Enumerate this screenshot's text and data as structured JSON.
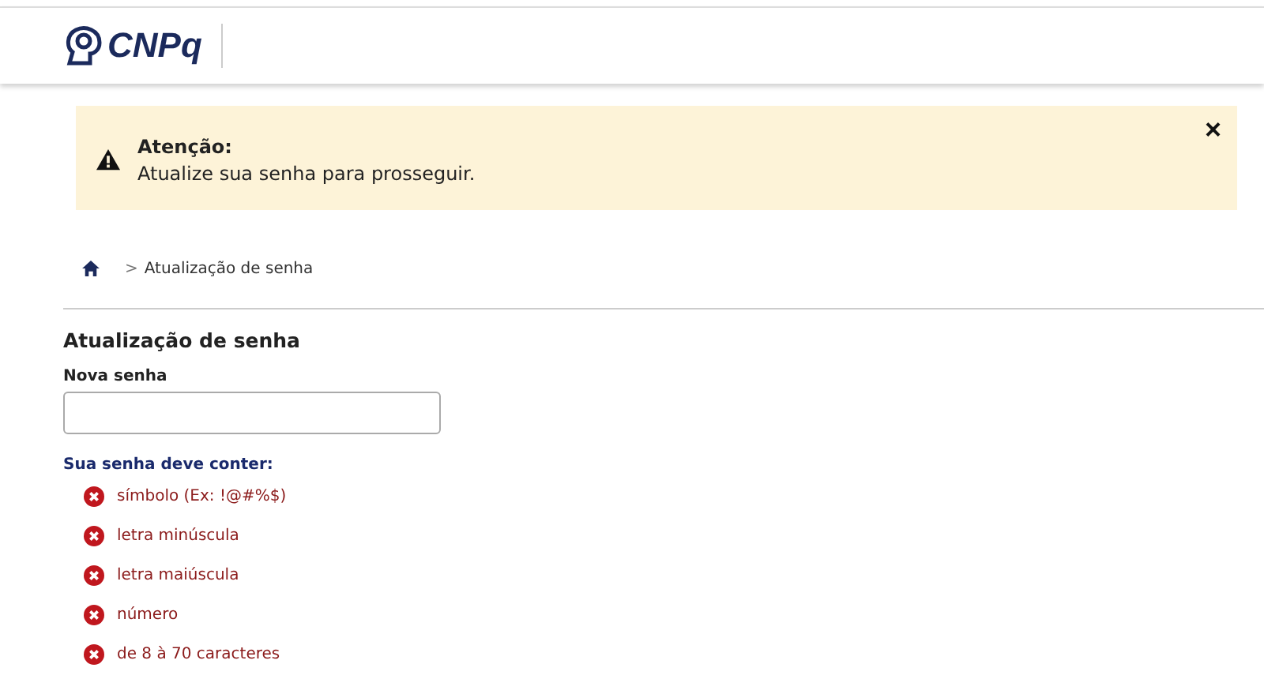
{
  "header": {
    "logo_text": "CNPq"
  },
  "alert": {
    "title": "Atenção:",
    "message": "Atualize sua senha para prosseguir.",
    "close": "×"
  },
  "breadcrumb": {
    "separator": ">",
    "current": "Atualização de senha"
  },
  "form": {
    "title": "Atualização de senha",
    "field_label": "Nova senha",
    "requirements_title": "Sua senha deve conter:",
    "requirements": [
      {
        "text": "símbolo (Ex: !@#%$)",
        "met": false
      },
      {
        "text": "letra minúscula",
        "met": false
      },
      {
        "text": "letra maiúscula",
        "met": false
      },
      {
        "text": "número",
        "met": false
      },
      {
        "text": "de 8 à 70 caracteres",
        "met": false
      }
    ]
  }
}
